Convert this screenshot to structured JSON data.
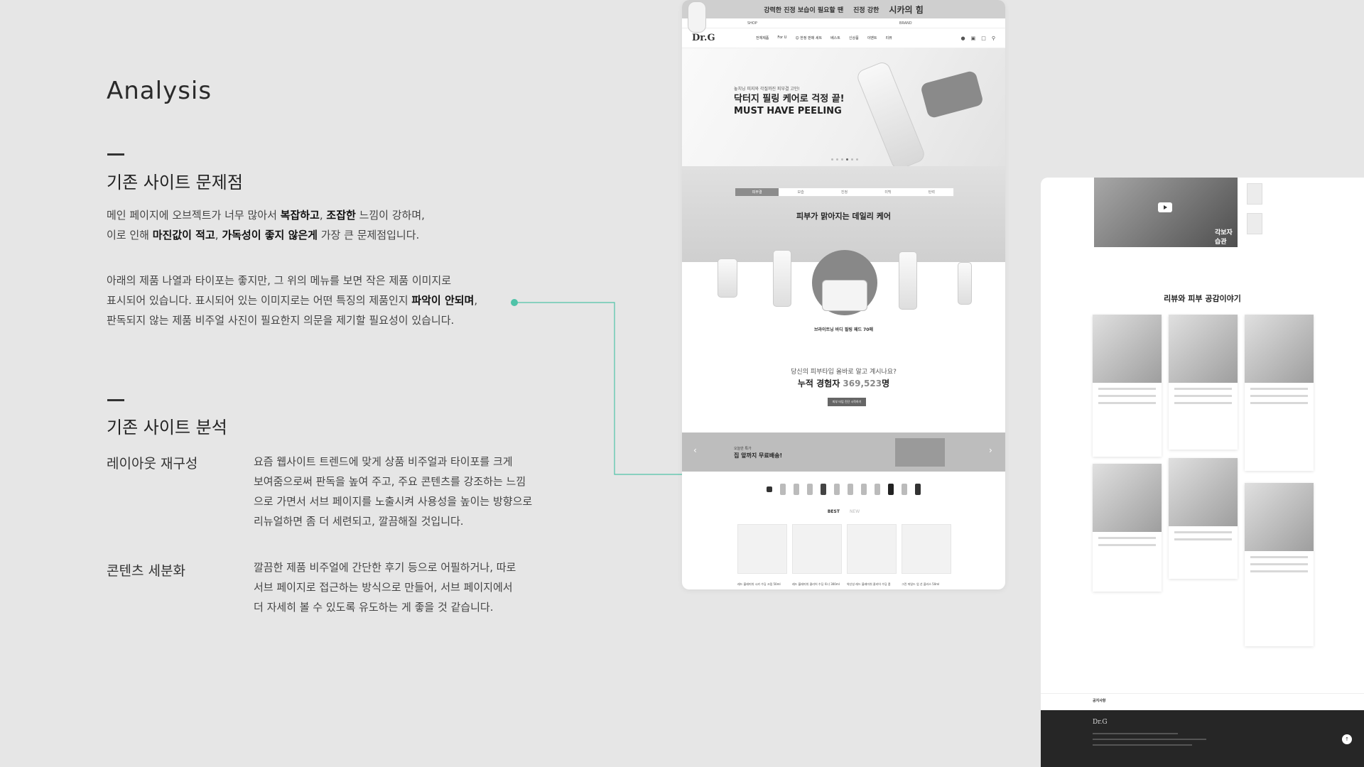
{
  "analysis": {
    "title": "Analysis",
    "section1": {
      "heading": "기존 사이트 문제점",
      "para1": {
        "line1_a": " 메인 페이지에 오브젝트가 너무 많아서 ",
        "line1_b1": "복잡하고",
        "line1_c": ", ",
        "line1_b2": "조잡한",
        "line1_d": " 느낌이 강하며,",
        "line2_a": "이로 인해 ",
        "line2_b1": "마진값이 적고",
        "line2_c": ", ",
        "line2_b2": "가독성이 좋지 않은게",
        "line2_d": " 가장 큰 문제점입니다."
      },
      "para2": {
        "line1": "아래의 제품 나열과 타이포는 좋지만, 그 위의 메뉴를 보면 작은 제품 이미지로",
        "line2_a": "표시되어 있습니다. 표시되어 있는 이미지로는 어떤 특징의 제품인지 ",
        "line2_b": "파악이 안되며",
        "line2_c": ",",
        "line3": "판독되지 않는 제품 비주얼 사진이 필요한지 의문을 제기할 필요성이 있습니다."
      }
    },
    "section2": {
      "heading": "기존 사이트 분석",
      "items": [
        {
          "label": "레이아웃 재구성",
          "lines": [
            "요즘 웹사이트 트렌드에 맞게 상품 비주얼과 타이포를 크게",
            "보여줌으로써 판독을 높여 주고, 주요 콘텐츠를 강조하는 느낌",
            "으로 가면서 서브 페이지를 노출시켜 사용성을 높이는 방향으로",
            "리뉴얼하면 좀 더 세련되고, 깔끔해질 것입니다."
          ]
        },
        {
          "label": "콘텐츠 세분화",
          "lines": [
            "깔끔한 제품 비주얼에 간단한 후기 등으로 어필하거나, 따로",
            "서브 페이지로 접근하는 방식으로 만들어, 서브 페이지에서",
            "더 자세히 볼 수 있도록 유도하는 게 좋을 것 같습니다."
          ]
        }
      ]
    },
    "accent_color": "#4fc3a8"
  },
  "site": {
    "promo": {
      "left": "강력한 진정 보습이 필요할 땐",
      "mid": "진정 강한",
      "big": "시카의 힘"
    },
    "util": {
      "shop": "SHOP",
      "brand": "BRAND"
    },
    "logo": "Dr.G",
    "menu": [
      "전체제품",
      "For U",
      "☺ 한정 판매 세트",
      "베스트",
      "신상품",
      "이벤트",
      "리뷰"
    ],
    "hero": {
      "small": "놓치닝 피지와 각질까진 피부결 고민!",
      "title1": "닥터지 필링 케어로 걱정 끝!",
      "title2": "MUST HAVE PEELING"
    },
    "tabs": [
      "피부결",
      "보습",
      "진정",
      "미백",
      "탄력"
    ],
    "daily_title": "피부가 맑아지는 데일리 케어",
    "featured_product": "브라이트닝 바디 필링 패드 70매",
    "question": "당신의 피부타입 올바로 알고 계시나요?",
    "count_label": "누적 경험자 ",
    "count_value": "369,523",
    "count_unit": "명",
    "cta": "피부 타입 진단 시작하기",
    "delivery_small": "오늘만 특가",
    "delivery_text": "집 앞까지 무료배송!",
    "best_tab": "BEST",
    "new_tab": "NEW",
    "best_captions": [
      "레드 블레미쉬 시카 수딩 크림 50ml",
      "레드 블레미쉬 클리어 수딩 토너 300ml",
      "약산성 레드 블레미쉬 클리어 수딩 폼",
      "그린 마일드 업 선 플러스 50ml"
    ]
  },
  "sub": {
    "video_tag": "각보자 습관",
    "review_title": "리뷰와 피부 공감이야기",
    "notice_label": "공지사항",
    "footer_logo": "Dr.G"
  }
}
